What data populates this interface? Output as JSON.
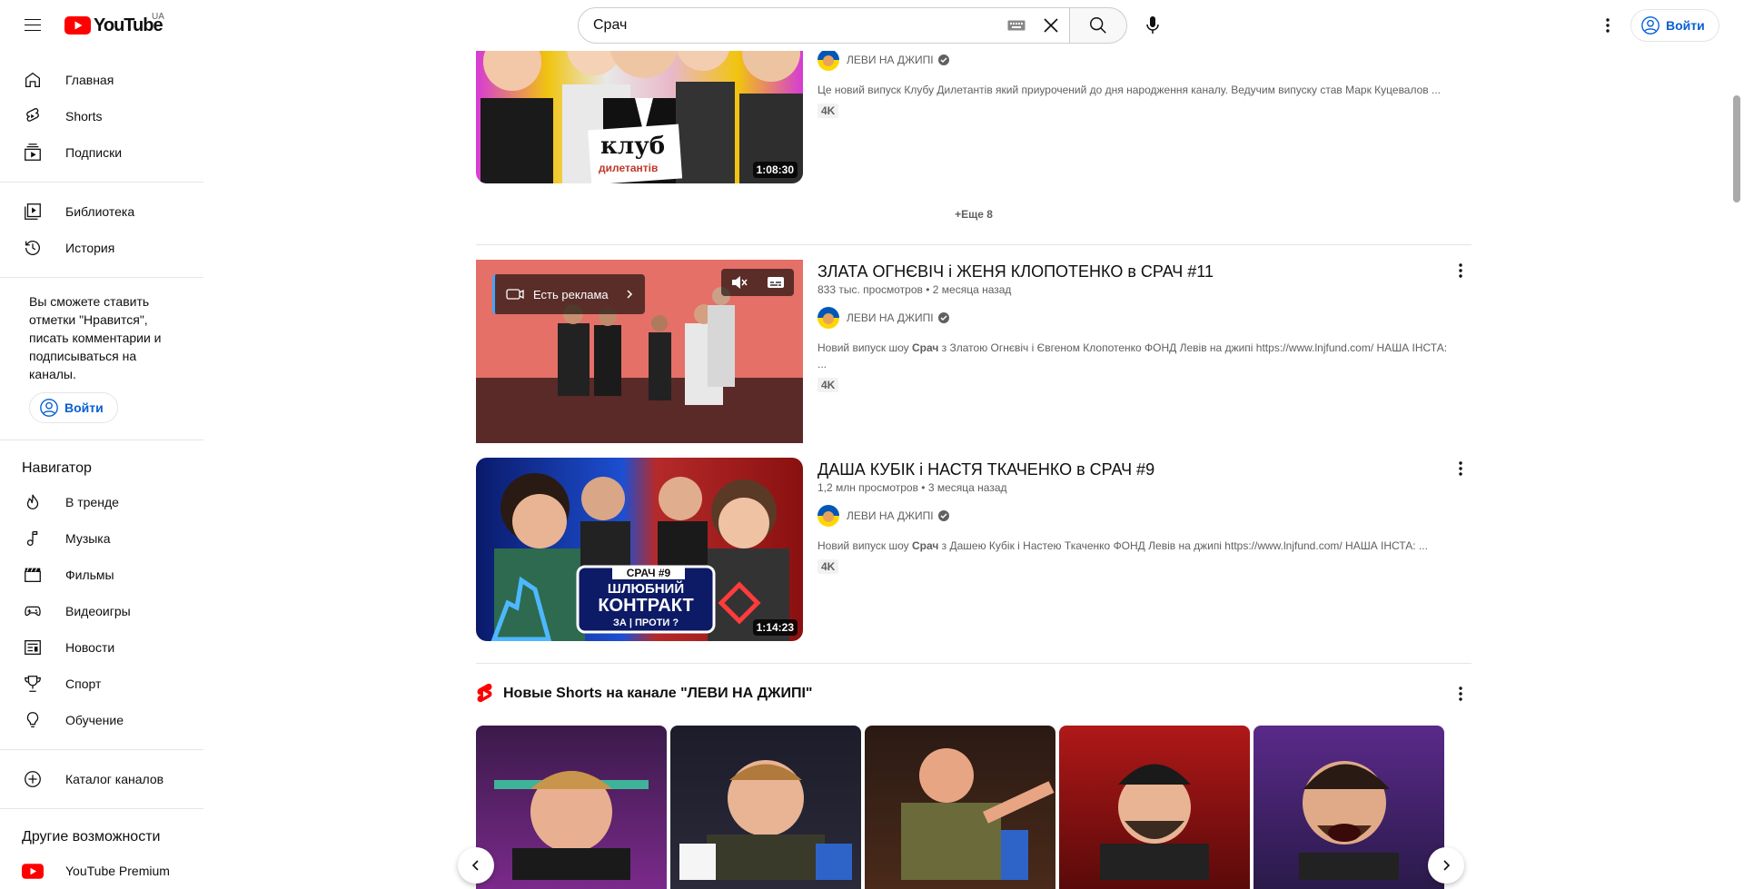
{
  "header": {
    "logo_text": "YouTube",
    "country_code": "UA",
    "search_query": "Срач",
    "signin_label": "Войти"
  },
  "sidebar": {
    "primary": [
      {
        "label": "Главная",
        "icon": "home-icon"
      },
      {
        "label": "Shorts",
        "icon": "shorts-icon"
      },
      {
        "label": "Подписки",
        "icon": "subscriptions-icon"
      }
    ],
    "secondary": [
      {
        "label": "Библиотека",
        "icon": "library-icon"
      },
      {
        "label": "История",
        "icon": "history-icon"
      }
    ],
    "signin_message": "Вы сможете ставить отметки \"Нравится\", писать комментарии и подписываться на каналы.",
    "signin_label": "Войти",
    "navigator_title": "Навигатор",
    "navigator": [
      {
        "label": "В тренде",
        "icon": "trending-icon"
      },
      {
        "label": "Музыка",
        "icon": "music-icon"
      },
      {
        "label": "Фильмы",
        "icon": "movies-icon"
      },
      {
        "label": "Видеоигры",
        "icon": "gaming-icon"
      },
      {
        "label": "Новости",
        "icon": "news-icon"
      },
      {
        "label": "Спорт",
        "icon": "sports-icon"
      },
      {
        "label": "Обучение",
        "icon": "learning-icon"
      }
    ],
    "catalog_label": "Каталог каналов",
    "more_title": "Другие возможности",
    "premium_label": "YouTube Premium"
  },
  "results": {
    "top_card": {
      "channel": "ЛЕВИ НА ДЖИПІ",
      "description": "Це новий випуск Клубу Дилетантів який приурочений до дня народження каналу. Ведучим випуску став Марк Куцевалов ...",
      "badge": "4K",
      "duration": "1:08:30",
      "thumb_text_1": "клуб",
      "thumb_text_2": "дилетантів"
    },
    "more_label": "+Еще 8",
    "videos": [
      {
        "title": "ЗЛАТА ОГНЄВІЧ і ЖЕНЯ КЛОПОТЕНКО в СРАЧ #11",
        "views": "833 тыс. просмотров",
        "age": "2 месяца назад",
        "channel": "ЛЕВИ НА ДЖИПІ",
        "desc_before": "Новий випуск шоу ",
        "desc_bold": "Срач",
        "desc_after": " з Златою Огнєвіч і Євгеном Клопотенко ФОНД Левів на джипі https://www.lnjfund.com/ НАША ІНСТА: ...",
        "badge": "4K",
        "ad_label": "Есть реклама"
      },
      {
        "title": "ДАША КУБІК і НАСТЯ ТКАЧЕНКО в СРАЧ #9",
        "views": "1,2 млн просмотров",
        "age": "3 месяца назад",
        "channel": "ЛЕВИ НА ДЖИПІ",
        "desc_before": "Новий випуск шоу ",
        "desc_bold": "Срач",
        "desc_after": " з Дашею Кубік і Настею Ткаченко ФОНД Левів на джипі https://www.lnjfund.com/ НАША ІНСТА: ...",
        "badge": "4K",
        "duration": "1:14:23",
        "thumb_line_1": "СРАЧ #9",
        "thumb_line_2": "ШЛЮБНИЙ",
        "thumb_line_3": "КОНТРАКТ",
        "thumb_line_4": "ЗА | ПРОТИ ?"
      }
    ],
    "shorts_title": "Новые Shorts на канале \"ЛЕВИ НА ДЖИПІ\""
  },
  "colors": {
    "accent_blue": "#065fd4",
    "youtube_red": "#ff0000"
  }
}
